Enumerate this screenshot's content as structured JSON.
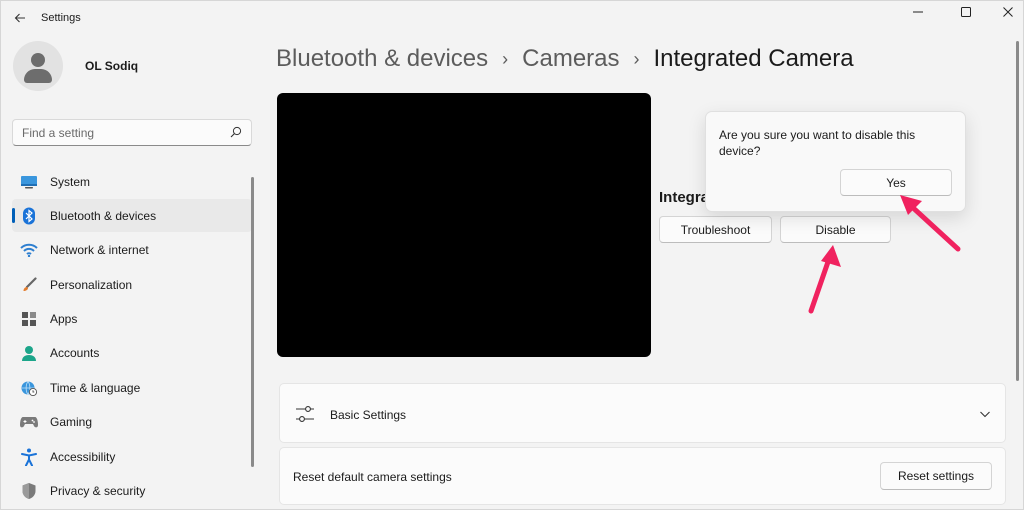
{
  "window": {
    "title": "Settings",
    "controls": {
      "minimize": "─",
      "maximize": "☐",
      "close": "✕"
    }
  },
  "profile": {
    "name": "OL Sodiq"
  },
  "search": {
    "placeholder": "Find a setting"
  },
  "sidebar": {
    "items": [
      {
        "label": "System",
        "icon": "system-icon",
        "selected": false
      },
      {
        "label": "Bluetooth & devices",
        "icon": "bluetooth-icon",
        "selected": true
      },
      {
        "label": "Network & internet",
        "icon": "wifi-icon",
        "selected": false
      },
      {
        "label": "Personalization",
        "icon": "brush-icon",
        "selected": false
      },
      {
        "label": "Apps",
        "icon": "apps-icon",
        "selected": false
      },
      {
        "label": "Accounts",
        "icon": "accounts-icon",
        "selected": false
      },
      {
        "label": "Time & language",
        "icon": "globe-clock-icon",
        "selected": false
      },
      {
        "label": "Gaming",
        "icon": "gamepad-icon",
        "selected": false
      },
      {
        "label": "Accessibility",
        "icon": "accessibility-icon",
        "selected": false
      },
      {
        "label": "Privacy & security",
        "icon": "shield-icon",
        "selected": false
      }
    ]
  },
  "breadcrumb": {
    "items": [
      "Bluetooth & devices",
      "Cameras",
      "Integrated Camera"
    ],
    "separator": "›"
  },
  "camera": {
    "name_partial": "Integrated Camera",
    "troubleshoot_label": "Troubleshoot",
    "disable_label": "Disable"
  },
  "flyout": {
    "message": "Are you sure you want to disable this device?",
    "yes_label": "Yes"
  },
  "basic_settings": {
    "label": "Basic Settings"
  },
  "reset": {
    "label": "Reset default camera settings",
    "button_label": "Reset settings"
  },
  "colors": {
    "accent": "#005fb8",
    "annotation_arrow": "#f0225f"
  }
}
